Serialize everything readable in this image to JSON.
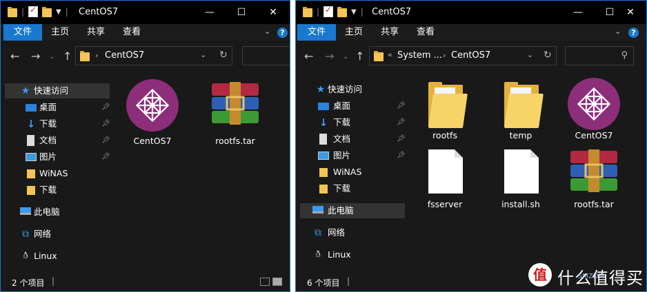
{
  "window_left": {
    "title": "CentOS7",
    "ribbon_tabs": [
      "文件",
      "主页",
      "共享",
      "查看"
    ],
    "address": [
      "CentOS7"
    ],
    "nav": [
      {
        "label": "快速访问",
        "icon": "star-icon"
      },
      {
        "label": "桌面",
        "icon": "desktop-icon",
        "pinned": true
      },
      {
        "label": "下载",
        "icon": "download-icon",
        "pinned": true
      },
      {
        "label": "文档",
        "icon": "document-icon",
        "pinned": true
      },
      {
        "label": "图片",
        "icon": "picture-icon",
        "pinned": true
      },
      {
        "label": "WiNAS",
        "icon": "folder-icon"
      },
      {
        "label": "下载",
        "icon": "folder-icon"
      },
      {
        "label": "此电脑",
        "icon": "computer-icon"
      },
      {
        "label": "网络",
        "icon": "network-icon"
      },
      {
        "label": "Linux",
        "icon": "linux-icon"
      }
    ],
    "files": [
      {
        "name": "CentOS7",
        "icon": "centos-icon"
      },
      {
        "name": "rootfs.tar",
        "icon": "winrar-archive-icon"
      }
    ],
    "status": "2 个项目"
  },
  "window_right": {
    "title": "CentOS7",
    "ribbon_tabs": [
      "文件",
      "主页",
      "共享",
      "查看"
    ],
    "address": [
      "System ...",
      "CentOS7"
    ],
    "address_prefix": "«",
    "nav": [
      {
        "label": "快速访问",
        "icon": "star-icon"
      },
      {
        "label": "桌面",
        "icon": "desktop-icon",
        "pinned": true
      },
      {
        "label": "下载",
        "icon": "download-icon",
        "pinned": true
      },
      {
        "label": "文档",
        "icon": "document-icon",
        "pinned": true
      },
      {
        "label": "图片",
        "icon": "picture-icon",
        "pinned": true
      },
      {
        "label": "WiNAS",
        "icon": "folder-icon"
      },
      {
        "label": "下载",
        "icon": "folder-icon"
      },
      {
        "label": "此电脑",
        "icon": "computer-icon"
      },
      {
        "label": "网络",
        "icon": "network-icon"
      },
      {
        "label": "Linux",
        "icon": "linux-icon"
      }
    ],
    "files": [
      {
        "name": "rootfs",
        "icon": "folder-icon"
      },
      {
        "name": "temp",
        "icon": "folder-icon"
      },
      {
        "name": "CentOS7",
        "icon": "centos-icon"
      },
      {
        "name": "fsserver",
        "icon": "blank-file-icon"
      },
      {
        "name": "install.sh",
        "icon": "blank-file-icon"
      },
      {
        "name": "rootfs.tar",
        "icon": "winrar-archive-icon"
      }
    ],
    "status": "6 个项目"
  },
  "controls": {
    "minimize": "—",
    "maximize": "☐",
    "close": "✕",
    "help": "?"
  },
  "watermark": {
    "logo": "值",
    "text": "什么值得买",
    "sub": "SMZDM"
  },
  "colors": {
    "accent": "#1979d0",
    "background": "#191919",
    "titlebar": "#000000",
    "centos": "#8d2e7a"
  }
}
